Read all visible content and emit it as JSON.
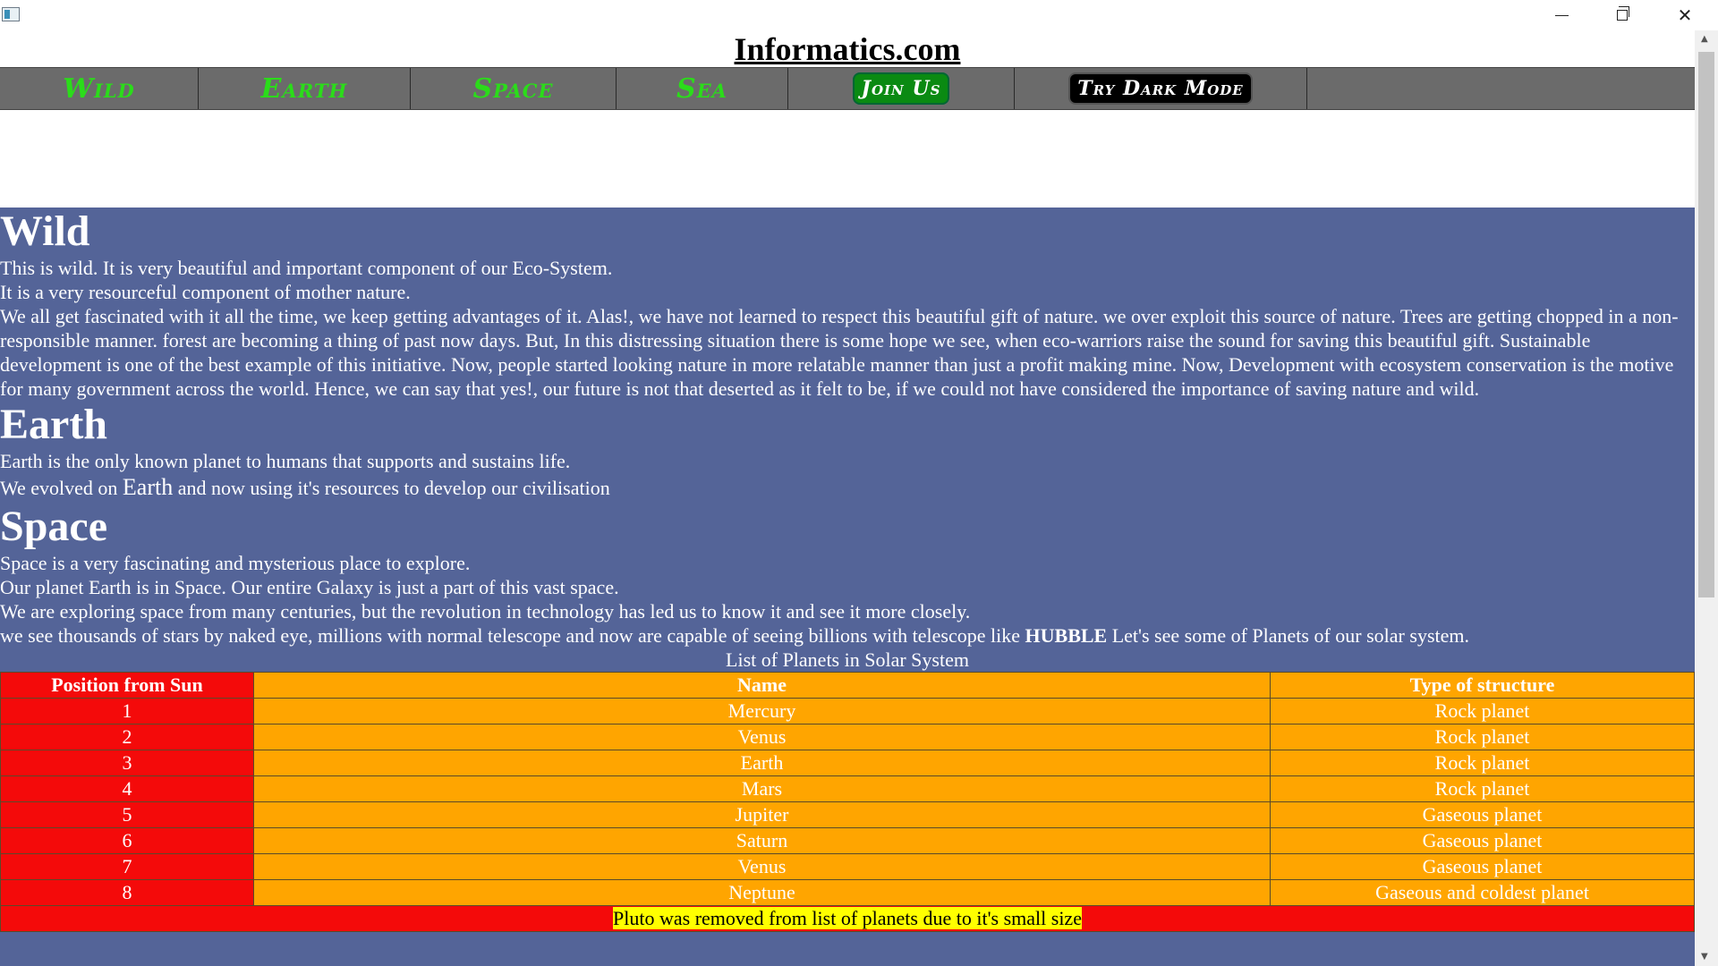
{
  "window": {
    "minimize_icon": "minimize-icon",
    "maximize_icon": "restore-icon",
    "close_icon": "close-icon"
  },
  "site_title": "Informatics.com",
  "nav": {
    "items": [
      "Wild",
      "Earth",
      "Space",
      "Sea"
    ],
    "join_label": "Join Us",
    "dark_label": "Try Dark Mode"
  },
  "sections": {
    "wild": {
      "heading": "Wild",
      "lines": [
        "This is wild. It is very beautiful and important component of our Eco-System.",
        "It is a very resourceful component of mother nature.",
        "We all get fascinated with it all the time, we keep getting advantages of it. Alas!, we have not learned to respect this beautiful gift of nature. we over exploit this source of nature. Trees are getting chopped in a non-responsible manner. forest are becoming a thing of past now days. But, In this distressing situation there is some hope we see, when eco-warriors raise the sound for saving this beautiful gift. Sustainable development is one of the best example of this initiative. Now, people started looking nature in more relatable manner than just a profit making mine. Now, Development with ecosystem conservation is the motive for many government across the world. Hence, we can say that yes!, our future is not that deserted as it felt to be, if we could not have considered the importance of saving nature and wild."
      ]
    },
    "earth": {
      "heading": "Earth",
      "line1": "Earth is the only known planet to humans that supports and sustains life.",
      "line2_pre": "We evolved on ",
      "line2_big": "Earth",
      "line2_post": " and now using it's resources to develop our civilisation"
    },
    "space": {
      "heading": "Space",
      "lines": [
        "Space is a very fascinating and mysterious place to explore.",
        "Our planet Earth is in Space. Our entire Galaxy is just a part of this vast space.",
        "We are exploring space from many centuries, but the revolution in technology has led us to know it and see it more closely."
      ],
      "line4_pre": "we see thousands of stars by naked eye, millions with normal telescope and now are capable of seeing billions with telescope like ",
      "line4_bold": "HUBBLE",
      "line4_post": " Let's see some of Planets of our solar system."
    }
  },
  "table": {
    "caption": "List of Planets in Solar System",
    "headers": [
      "Position from Sun",
      "Name",
      "Type of structure"
    ],
    "rows": [
      [
        "1",
        "Mercury",
        "Rock planet"
      ],
      [
        "2",
        "Venus",
        "Rock planet"
      ],
      [
        "3",
        "Earth",
        "Rock planet"
      ],
      [
        "4",
        "Mars",
        "Rock planet"
      ],
      [
        "5",
        "Jupiter",
        "Gaseous planet"
      ],
      [
        "6",
        "Saturn",
        "Gaseous planet"
      ],
      [
        "7",
        "Venus",
        "Gaseous planet"
      ],
      [
        "8",
        "Neptune",
        "Gaseous and coldest planet"
      ]
    ],
    "footer": "Pluto was removed from list of planets due to it's small size"
  },
  "colors": {
    "nav_text": "#2bdc1a",
    "content_bg": "#546498",
    "position_col": "#f40a0a",
    "name_col": "#ffa500",
    "highlight": "#ffff00"
  }
}
